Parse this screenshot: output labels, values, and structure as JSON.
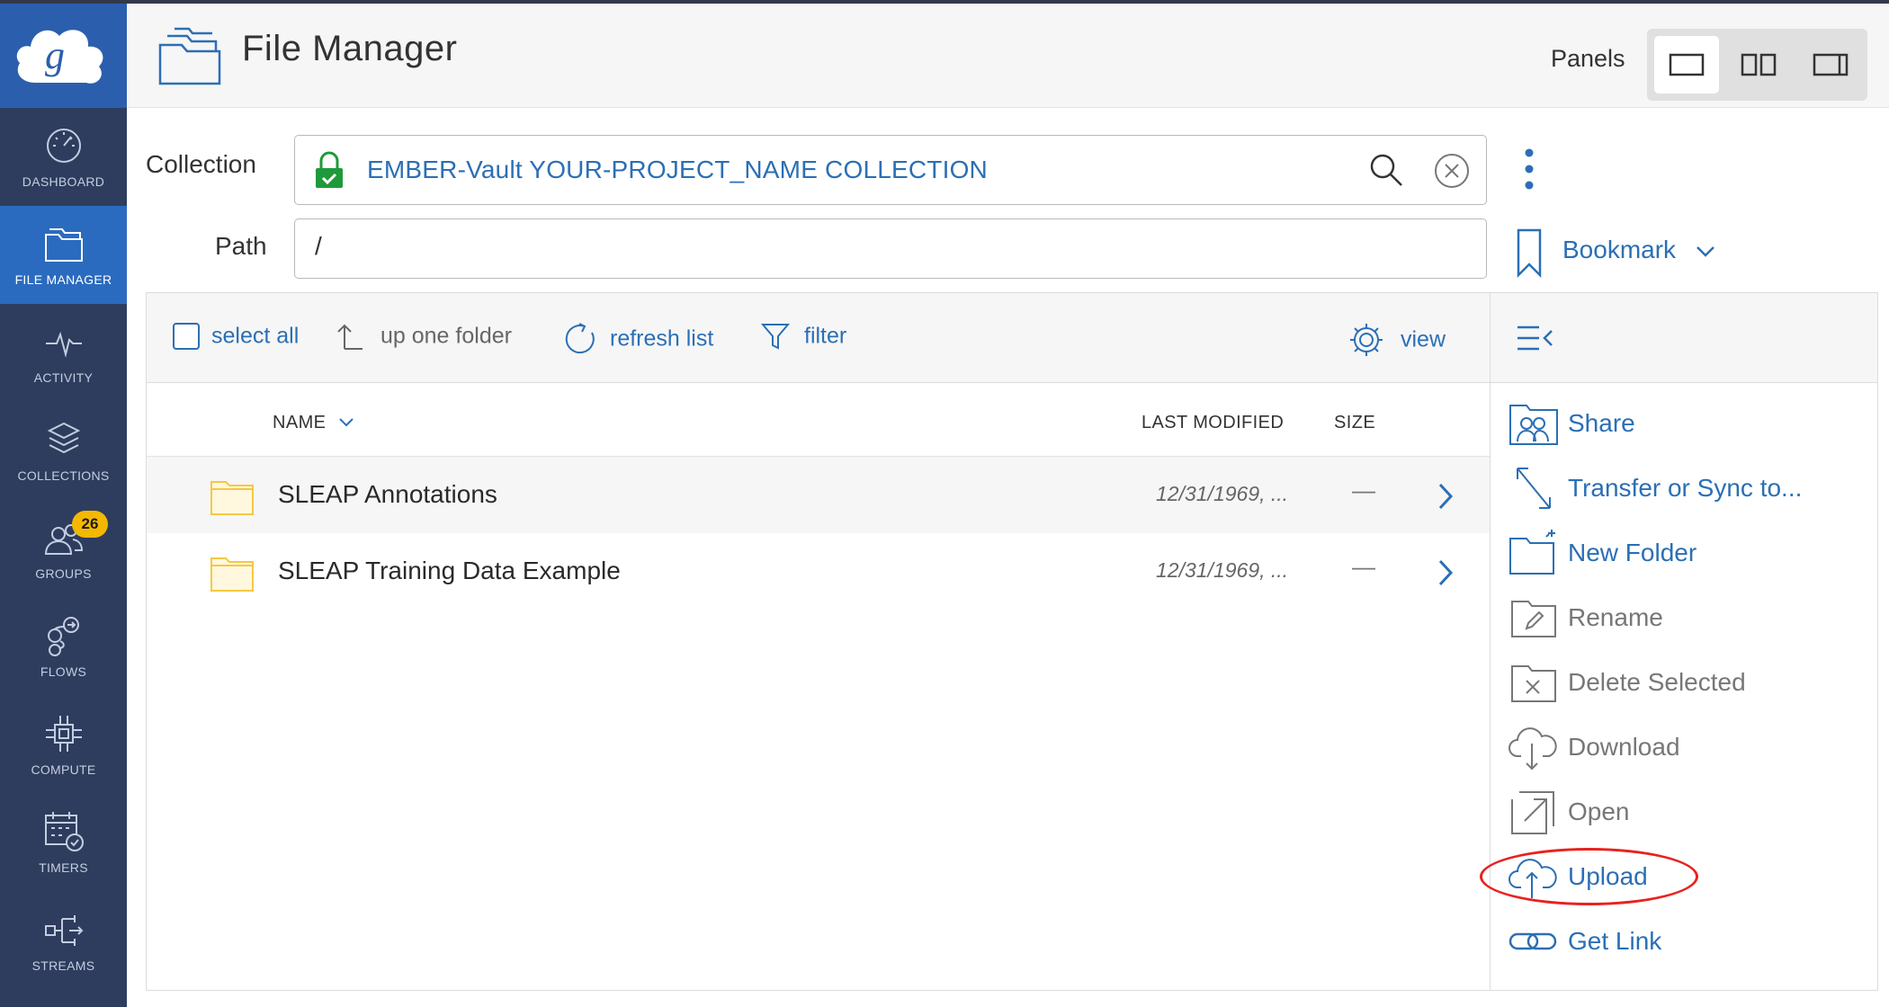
{
  "app": {
    "title": "File Manager"
  },
  "sidebar": {
    "logo": "globus-logo",
    "items": [
      {
        "label": "DASHBOARD",
        "icon": "dashboard-icon",
        "active": false
      },
      {
        "label": "FILE MANAGER",
        "icon": "file-manager-icon",
        "active": true
      },
      {
        "label": "ACTIVITY",
        "icon": "activity-icon",
        "active": false
      },
      {
        "label": "COLLECTIONS",
        "icon": "collections-icon",
        "active": false
      },
      {
        "label": "GROUPS",
        "icon": "groups-icon",
        "active": false,
        "badge": "26"
      },
      {
        "label": "FLOWS",
        "icon": "flows-icon",
        "active": false
      },
      {
        "label": "COMPUTE",
        "icon": "compute-icon",
        "active": false
      },
      {
        "label": "TIMERS",
        "icon": "timers-icon",
        "active": false
      },
      {
        "label": "STREAMS",
        "icon": "streams-icon",
        "active": false
      }
    ]
  },
  "header": {
    "panels_label": "Panels",
    "panel_options": [
      "single-panel",
      "dual-panel",
      "panel-right"
    ],
    "selected_panel": "single-panel"
  },
  "collection": {
    "label": "Collection",
    "value": "EMBER-Vault YOUR-PROJECT_NAME COLLECTION"
  },
  "path": {
    "label": "Path",
    "value": "/"
  },
  "bookmark": {
    "label": "Bookmark"
  },
  "toolbar": {
    "select_all": "select all",
    "up_one_folder": "up one folder",
    "refresh_list": "refresh list",
    "filter": "filter",
    "view": "view"
  },
  "table": {
    "columns": {
      "name": "NAME",
      "last_modified": "LAST MODIFIED",
      "size": "SIZE"
    },
    "rows": [
      {
        "name": "SLEAP Annotations",
        "last_modified": "12/31/1969, ...",
        "size": "—"
      },
      {
        "name": "SLEAP Training Data Example",
        "last_modified": "12/31/1969, ...",
        "size": "—"
      }
    ]
  },
  "actions": [
    {
      "label": "Share",
      "icon": "share-icon",
      "enabled": true
    },
    {
      "label": "Transfer or Sync to...",
      "icon": "transfer-icon",
      "enabled": true
    },
    {
      "label": "New Folder",
      "icon": "new-folder-icon",
      "enabled": true
    },
    {
      "label": "Rename",
      "icon": "rename-icon",
      "enabled": false
    },
    {
      "label": "Delete Selected",
      "icon": "delete-icon",
      "enabled": false
    },
    {
      "label": "Download",
      "icon": "download-icon",
      "enabled": false
    },
    {
      "label": "Open",
      "icon": "open-icon",
      "enabled": false
    },
    {
      "label": "Upload",
      "icon": "upload-icon",
      "enabled": true,
      "highlighted": true
    },
    {
      "label": "Get Link",
      "icon": "get-link-icon",
      "enabled": true
    }
  ],
  "colors": {
    "sidebar_bg": "#2e3d5e",
    "sidebar_active": "#2b6bbf",
    "accent": "#2b6fb5",
    "badge": "#f5b800",
    "folder": "#f5c842",
    "lock": "#1f9a3a",
    "highlight": "#e8221f"
  }
}
